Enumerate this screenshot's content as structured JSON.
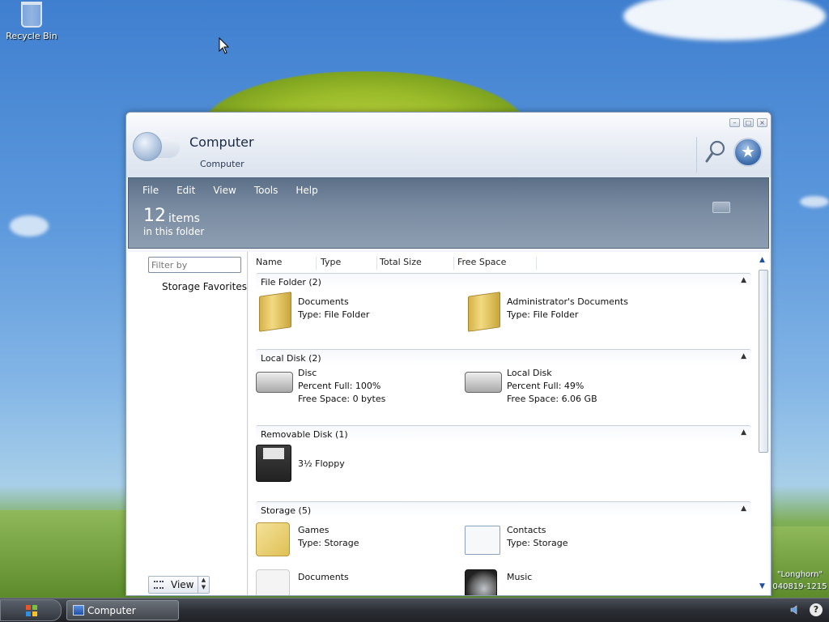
{
  "desktop": {
    "recycle_bin_label": "Recycle Bin",
    "watermark_line1": "\"Longhorn\"",
    "watermark_line2": "040819-1215"
  },
  "window": {
    "title": "Computer",
    "subtitle": "Computer",
    "controls": {
      "minimize": "–",
      "maximize": "□",
      "close": "×"
    }
  },
  "menu": [
    "File",
    "Edit",
    "View",
    "Tools",
    "Help"
  ],
  "summary": {
    "count": "12",
    "count_word": "items",
    "subtitle": "in this folder"
  },
  "left_pane": {
    "filter_placeholder": "Filter by",
    "storage_favorites": "Storage Favorites",
    "view_button": "View"
  },
  "columns": [
    "Name",
    "Type",
    "Total Size",
    "Free Space"
  ],
  "groups": [
    {
      "label": "File Folder (2)",
      "items": [
        {
          "icon": "folder-icon",
          "lines": [
            "Documents",
            "Type: File Folder"
          ]
        },
        {
          "icon": "folder-icon",
          "lines": [
            "Administrator's Documents",
            "Type: File Folder"
          ]
        }
      ]
    },
    {
      "label": "Local Disk (2)",
      "items": [
        {
          "icon": "hard-disk-icon",
          "lines": [
            "Disc",
            "Percent Full: 100%",
            "Free Space: 0 bytes"
          ]
        },
        {
          "icon": "windows-disk-icon",
          "lines": [
            "Local Disk",
            "Percent Full: 49%",
            "Free Space: 6.06 GB"
          ]
        }
      ]
    },
    {
      "label": "Removable Disk (1)",
      "items": [
        {
          "icon": "floppy-icon",
          "lines": [
            "3½ Floppy"
          ]
        }
      ]
    },
    {
      "label": "Storage (5)",
      "items": [
        {
          "icon": "games-icon",
          "lines": [
            "Games",
            "Type: Storage"
          ]
        },
        {
          "icon": "contacts-icon",
          "lines": [
            "Contacts",
            "Type: Storage"
          ]
        },
        {
          "icon": "documents-storage-icon",
          "lines": [
            "Documents"
          ]
        },
        {
          "icon": "music-icon",
          "lines": [
            "Music"
          ]
        }
      ]
    }
  ],
  "taskbar": {
    "task_label": "Computer"
  }
}
